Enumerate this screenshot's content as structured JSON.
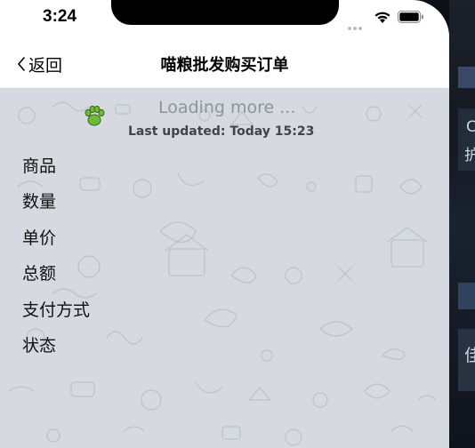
{
  "status_bar": {
    "time": "3:24"
  },
  "nav": {
    "back_label": "返回",
    "title": "喵粮批发购买订单"
  },
  "refresh": {
    "loading_text": "Loading more ...",
    "updated_text": "Last updated: Today 15:23"
  },
  "order_fields": [
    {
      "label": "商品"
    },
    {
      "label": "数量"
    },
    {
      "label": "单价"
    },
    {
      "label": "总额"
    },
    {
      "label": "支付方式"
    },
    {
      "label": "状态"
    }
  ],
  "background_glyphs": [
    "C",
    "护",
    "佳"
  ],
  "colors": {
    "nav_background": "#ffffff",
    "content_background": "#d6d9e0",
    "paw_green": "#6fba3a"
  }
}
